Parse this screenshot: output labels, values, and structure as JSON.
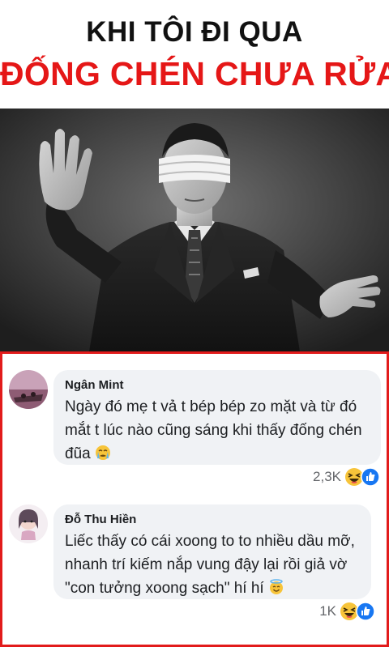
{
  "header": {
    "line1": "KHI TÔI ĐI QUA",
    "line2": "ĐỐNG CHÉN CHƯA RỬA"
  },
  "colors": {
    "title_red": "#e51717",
    "frame_red": "#e21b1b",
    "bubble_bg": "#f0f2f5"
  },
  "comments": [
    {
      "author": "Ngân Mint",
      "lines": [
        "Ngày đó mẹ t vả t bép bép zo mặt và từ đó",
        "mắt t lúc nào cũng sáng khi thấy đống  chén",
        "đũa"
      ],
      "emoji": "crying-face",
      "reaction_count": "2,3K",
      "reactions": [
        "haha",
        "like"
      ]
    },
    {
      "author": "Đỗ Thu Hiền",
      "lines": [
        "Liếc thấy có cái xoong to to nhiều dầu mỡ,",
        "nhanh trí kiếm nắp vung đậy lại rồi giả vờ",
        "\"con tưởng xoong sạch\" hí hí"
      ],
      "emoji": "smiling-face-with-halo",
      "reaction_count": "1K",
      "reactions": [
        "haha",
        "like"
      ]
    }
  ]
}
